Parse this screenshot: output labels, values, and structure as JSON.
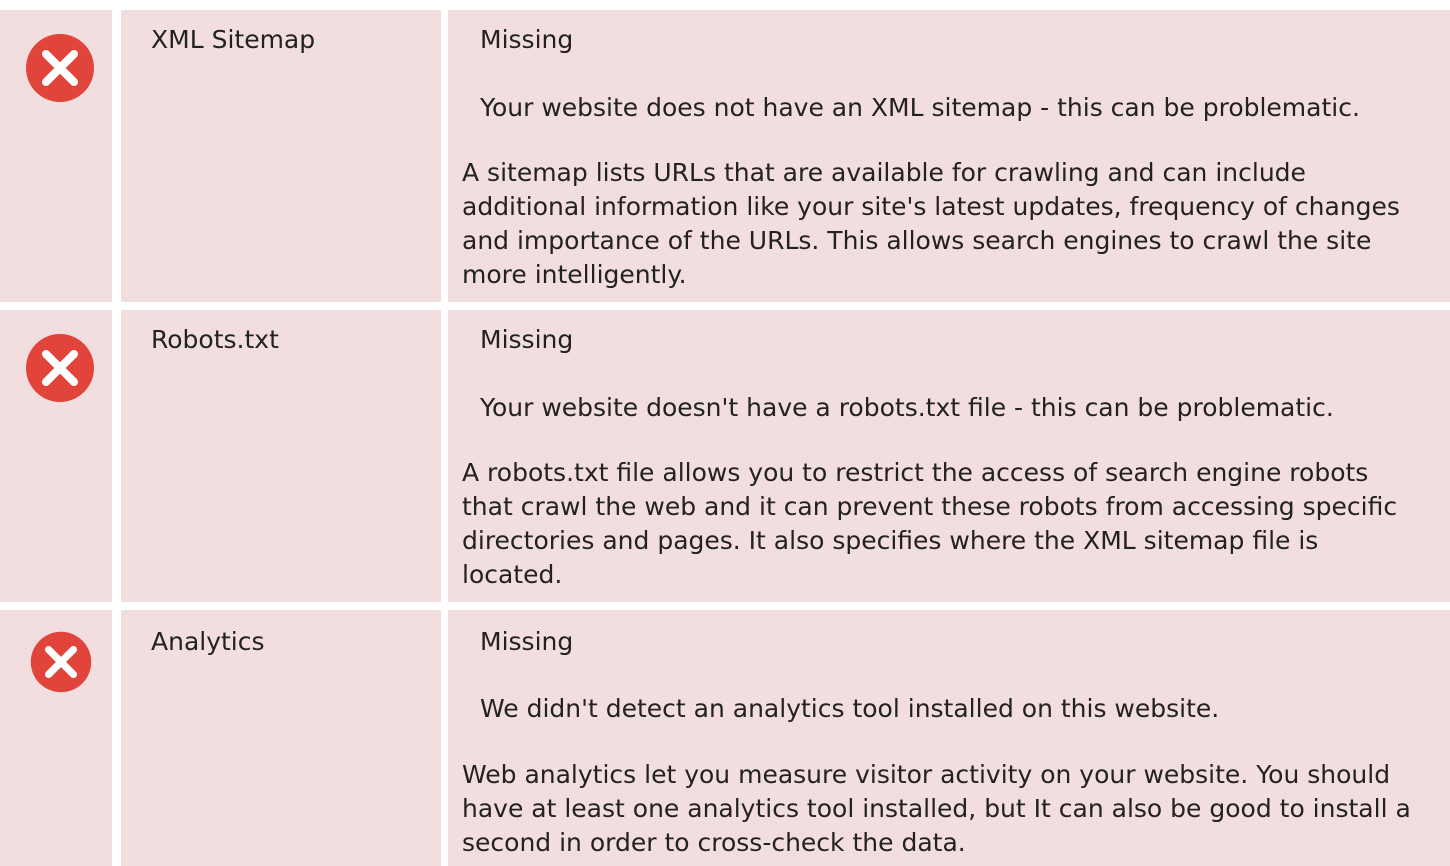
{
  "colors": {
    "row_background": "#f2dede",
    "icon_fill": "#e0443b",
    "icon_mark": "#ffffff",
    "text": "#222222"
  },
  "rows": [
    {
      "icon": "error-x-icon",
      "name": "XML Sitemap",
      "status": "Missing",
      "message": "Your website does not have an XML sitemap - this can be problematic.",
      "description": "A sitemap lists URLs that are available for crawling and can include additional information like your site's latest updates, frequency of changes and importance of the URLs. This allows search engines to crawl the site more intelligently."
    },
    {
      "icon": "error-x-icon",
      "name": "Robots.txt",
      "status": "Missing",
      "message": "Your website doesn't have a robots.txt file - this can be problematic.",
      "description": "A robots.txt file allows you to restrict the access of search engine robots that crawl the web and it can prevent these robots from accessing specific directories and pages. It also specifies where the XML sitemap file is located."
    },
    {
      "icon": "error-x-icon",
      "name": "Analytics",
      "status": "Missing",
      "message": "We didn't detect an analytics tool installed on this website.",
      "description": "Web analytics let you measure visitor activity on your website. You should have at least one analytics tool installed, but It can also be good to install a second in order to cross-check the data."
    }
  ]
}
